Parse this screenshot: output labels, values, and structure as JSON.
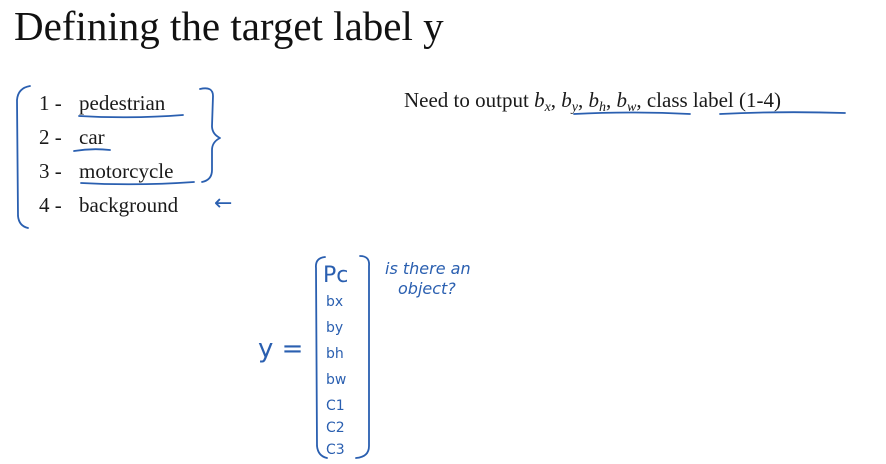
{
  "title": "Defining the target label y",
  "classes": [
    {
      "num": "1 -",
      "label": "pedestrian"
    },
    {
      "num": "2 -",
      "label": "car"
    },
    {
      "num": "3 -",
      "label": "motorcycle"
    },
    {
      "num": "4 -",
      "label": "background"
    }
  ],
  "output_text": {
    "prefix": "Need to output ",
    "b": "b",
    "sub_x": "x",
    "sub_y": "y",
    "sub_h": "h",
    "sub_w": "w",
    "sep": ", ",
    "class_label": "class label (1-4)"
  },
  "handwriting": {
    "y_equals": "y =",
    "vector": [
      "Pc",
      "bx",
      "by",
      "bh",
      "bw",
      "C1",
      "C2",
      "C3"
    ],
    "note_line1": "is there an",
    "note_line2": "object?",
    "arrow": "←"
  },
  "colors": {
    "ink": "#2a5fb0",
    "text": "#1a1a1a"
  }
}
